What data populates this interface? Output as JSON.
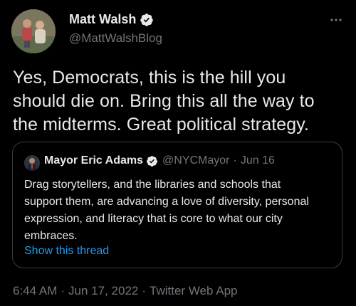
{
  "tweet": {
    "author_name": "Matt Walsh",
    "author_handle": "@MattWalshBlog",
    "text_lines": [
      "Yes, Democrats, this is the hill you",
      "should die on. Bring this all the way to",
      "the midterms. Great political strategy."
    ],
    "timestamp": "6:44 AM",
    "date": "Jun 17, 2022",
    "client": "Twitter Web App",
    "separator": "·"
  },
  "quote": {
    "author_name": "Mayor Eric Adams",
    "author_handle": "@NYCMayor",
    "separator": "·",
    "date": "Jun 16",
    "text_lines": [
      "Drag storytellers, and the libraries and schools that",
      "support them, are advancing a love of diversity, personal",
      "expression, and literacy that is core to what our city",
      "embraces."
    ],
    "show_thread_label": "Show this thread"
  },
  "icons": {
    "verified": "verified-badge-icon",
    "more": "more-options-icon"
  },
  "colors": {
    "background": "#000000",
    "text_primary": "#e7e9ea",
    "text_secondary": "#71767b",
    "link": "#1d9bf0",
    "border": "#3a3d41"
  }
}
